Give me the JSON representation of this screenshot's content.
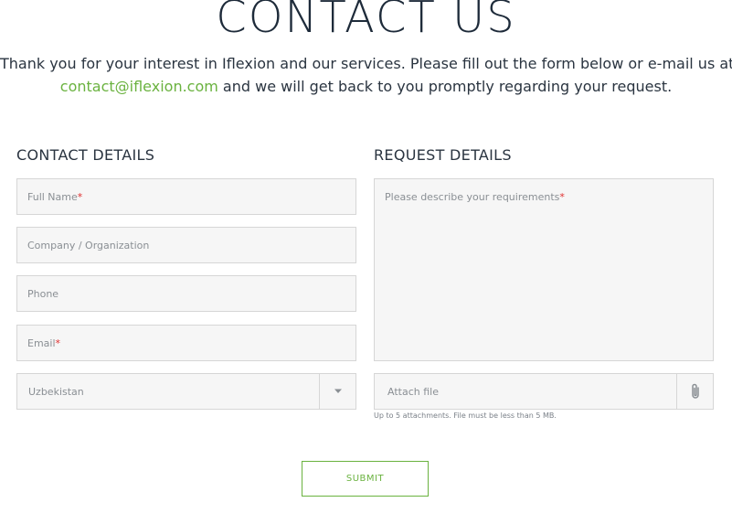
{
  "page": {
    "title": "CONTACT US",
    "intro_line1": "Thank you for your interest in Iflexion and our services. Please fill out the form below or e-mail us at",
    "intro_email": "contact@iflexion.com",
    "intro_line2_rest": " and we will get back to you promptly regarding your request."
  },
  "contact_details": {
    "heading": "CONTACT DETAILS",
    "full_name_placeholder": "Full Name",
    "company_placeholder": "Company / Organization",
    "phone_placeholder": "Phone",
    "email_placeholder": "Email",
    "country_value": "Uzbekistan",
    "required_mark": "*"
  },
  "request_details": {
    "heading": "REQUEST DETAILS",
    "requirements_placeholder": "Please describe your requirements",
    "attach_label": "Attach file",
    "attach_hint": "Up to 5 attachments. File must be less than 5 MB.",
    "required_mark": "*"
  },
  "form": {
    "submit_label": "SUBMIT"
  },
  "colors": {
    "accent": "#6ab23f",
    "required": "#e03030",
    "field_bg": "#f6f6f6",
    "field_border": "#d6d6d6"
  },
  "icons": {
    "country_select": "chevron-down-icon",
    "attach": "paperclip-icon"
  }
}
